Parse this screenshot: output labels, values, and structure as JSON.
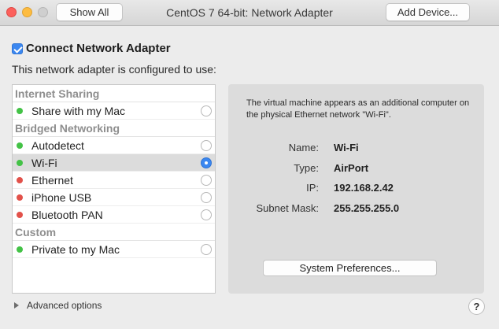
{
  "window": {
    "title": "CentOS 7 64-bit: Network Adapter",
    "show_all_label": "Show All",
    "add_device_label": "Add Device..."
  },
  "connect": {
    "label": "Connect Network Adapter",
    "checked": true
  },
  "configured_text": "This network adapter is configured to use:",
  "adapters": {
    "internet_sharing": {
      "header": "Internet Sharing",
      "items": [
        {
          "label": "Share with my Mac",
          "status": "green",
          "selected": false
        }
      ]
    },
    "bridged": {
      "header": "Bridged Networking",
      "items": [
        {
          "label": "Autodetect",
          "status": "green",
          "selected": false
        },
        {
          "label": "Wi-Fi",
          "status": "green",
          "selected": true
        },
        {
          "label": "Ethernet",
          "status": "red",
          "selected": false
        },
        {
          "label": "iPhone USB",
          "status": "red",
          "selected": false
        },
        {
          "label": "Bluetooth PAN",
          "status": "red",
          "selected": false
        }
      ]
    },
    "custom": {
      "header": "Custom",
      "items": [
        {
          "label": "Private to my Mac",
          "status": "green",
          "selected": false
        }
      ]
    }
  },
  "detail": {
    "description": "The virtual machine appears as an additional computer on the physical Ethernet network \"Wi-Fi\".",
    "name_label": "Name:",
    "name_value": "Wi-Fi",
    "type_label": "Type:",
    "type_value": "AirPort",
    "ip_label": "IP:",
    "ip_value": "192.168.2.42",
    "subnet_label": "Subnet Mask:",
    "subnet_value": "255.255.255.0",
    "system_prefs_label": "System Preferences..."
  },
  "footer": {
    "advanced_label": "Advanced options",
    "help_label": "?"
  },
  "colors": {
    "accent": "#3b87f0",
    "status_green": "#43c246",
    "status_red": "#e2514a",
    "close": "#fc605c",
    "minimize": "#fdbc40"
  }
}
